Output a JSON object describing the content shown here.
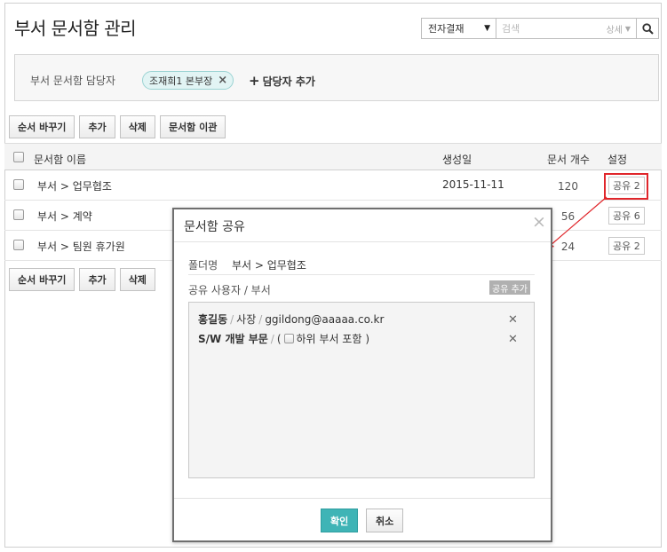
{
  "page": {
    "title": "부서 문서함 관리"
  },
  "search": {
    "scope_value": "전자결재",
    "placeholder": "검색",
    "detail_label": "상세"
  },
  "owners": {
    "label": "부서 문서함 담당자",
    "chip_label": "조재희1 본부장",
    "add_label": "담당자 추가"
  },
  "toolbar": {
    "reorder_label": "순서 바꾸기",
    "add_label": "추가",
    "delete_label": "삭제",
    "transfer_label": "문서함 이관"
  },
  "table": {
    "columns": {
      "name": "문서함 이름",
      "created": "생성일",
      "count": "문서 개수",
      "settings": "설정"
    },
    "rows": [
      {
        "name": "부서 > 업무협조",
        "created": "2015-11-11",
        "count": "120",
        "share": "공유 2"
      },
      {
        "name": "부서 > 계약",
        "created": "",
        "count": "56",
        "share": "공유 6"
      },
      {
        "name": "부서 > 팀원 휴가원",
        "created": "",
        "count": "24",
        "share": "공유 2"
      }
    ]
  },
  "modal": {
    "title": "문서함 공유",
    "folder_label": "폴더명",
    "folder_value": "부서 > 업무협조",
    "share_users_label": "공유 사용자 / 부서",
    "share_add_label": "공유 추가",
    "items": [
      {
        "name": "홍길동",
        "role": "사장",
        "email": "ggildong@aaaaa.co.kr"
      },
      {
        "name": "S/W 개발 부문",
        "paren_open": "(",
        "include_label": "하위 부서 포함",
        "paren_close": ")"
      }
    ],
    "confirm_label": "확인",
    "cancel_label": "취소"
  },
  "colors": {
    "accent": "#3fb4b6",
    "chip_bg": "#e2f4f4",
    "highlight": "#e0262b"
  }
}
